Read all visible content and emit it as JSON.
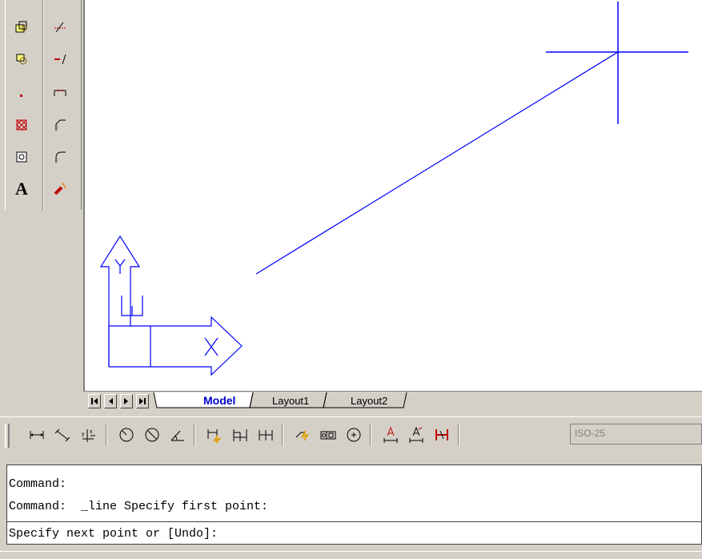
{
  "tabs": {
    "model": "Model",
    "layout1": "Layout1",
    "layout2": "Layout2"
  },
  "ucs": {
    "y_label": "Y",
    "w_label": "W",
    "x_label": "X"
  },
  "toolbar_left": {
    "col1_icons": [
      "block-insert-icon",
      "make-block-icon",
      "point-icon",
      "hatch-icon",
      "region-icon",
      "multiline-text-icon"
    ],
    "col2_icons": [
      "trim-icon",
      "extend-icon",
      "break-icon",
      "chamfer-icon",
      "fillet-icon",
      "explode-icon"
    ],
    "text_icon_glyph": "A"
  },
  "dimension_toolbar": {
    "dim_style": "ISO-25"
  },
  "command": {
    "line1": "Command:",
    "line2": "Command:  _line Specify first point:",
    "prompt": "Specify next point or [Undo]:"
  },
  "colors": {
    "drawing_blue": "#0000ff",
    "accent_tab": "#0000cc"
  }
}
